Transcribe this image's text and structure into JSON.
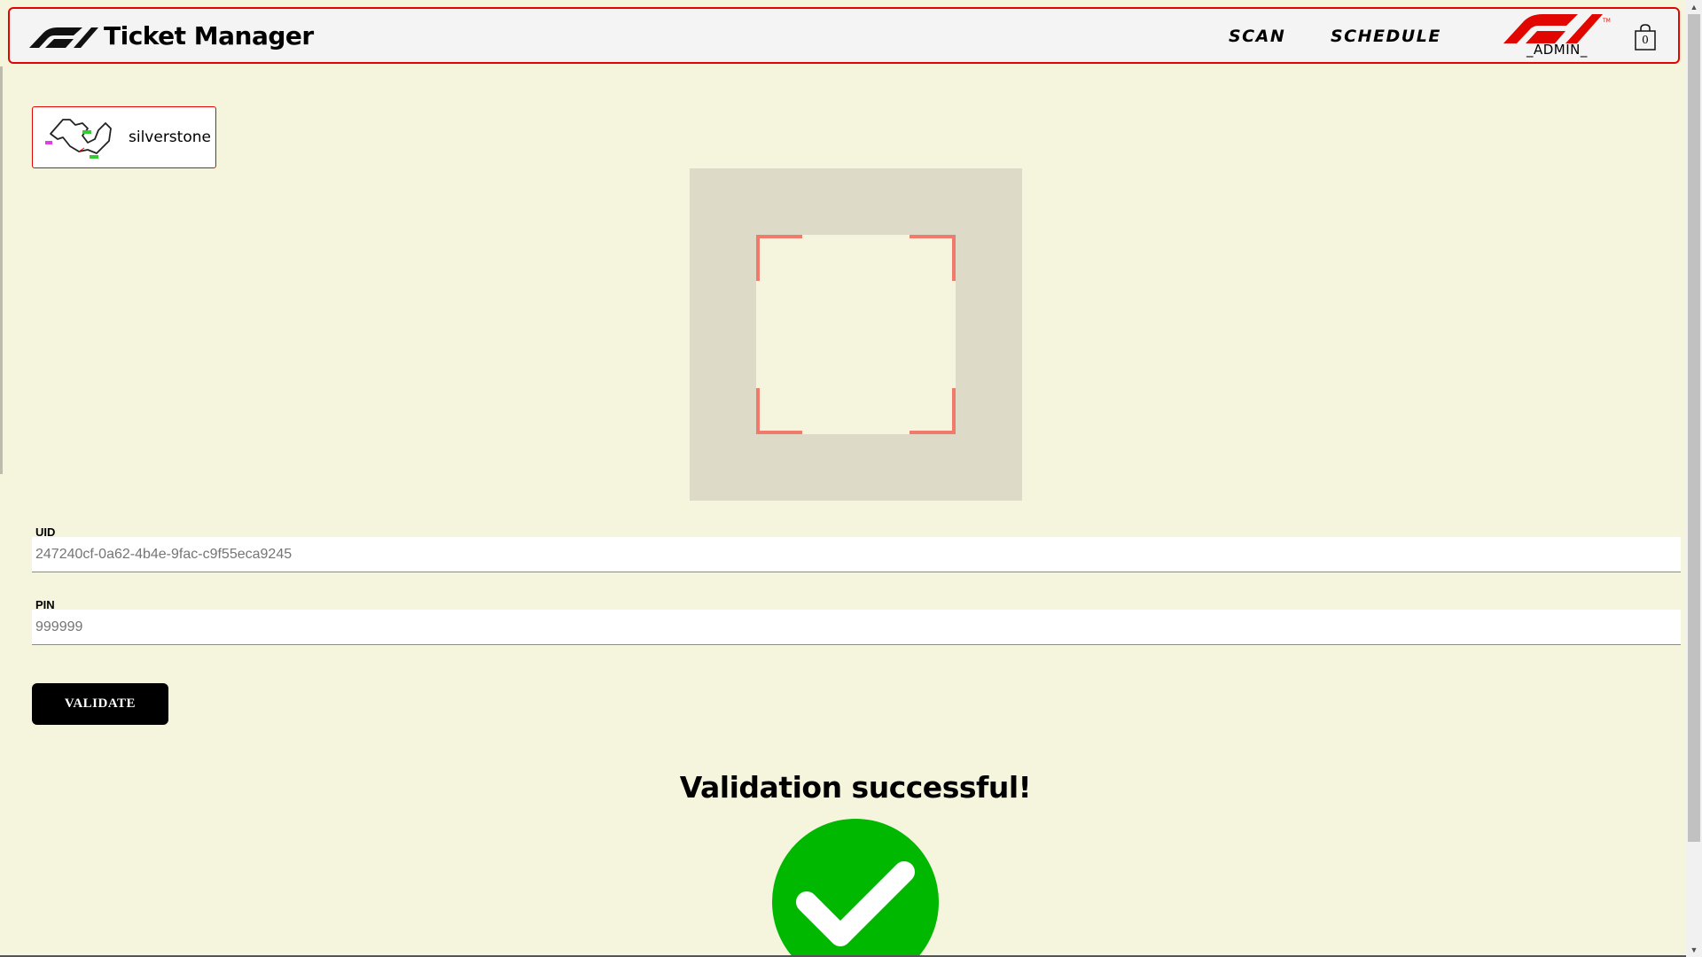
{
  "header": {
    "title": "Ticket Manager",
    "nav": {
      "scan": "SCAN",
      "schedule": "SCHEDULE"
    },
    "admin_label": "_ADMIN_",
    "cart_count": "0",
    "accent_color": "#e10600"
  },
  "circuit": {
    "name": "silverstone"
  },
  "form": {
    "uid_label": "UID",
    "uid_value": "247240cf-0a62-4b4e-9fac-c9f55eca9245",
    "pin_label": "PIN",
    "pin_value": "999999",
    "validate_label": "VALIDATE"
  },
  "result": {
    "title": "Validation successful!",
    "status_color": "#00b800"
  },
  "icons": [
    "f1-logo",
    "f1-admin-logo",
    "shopping-bag-icon",
    "circuit-map-icon",
    "scanner-frame",
    "checkmark-circle-icon"
  ]
}
